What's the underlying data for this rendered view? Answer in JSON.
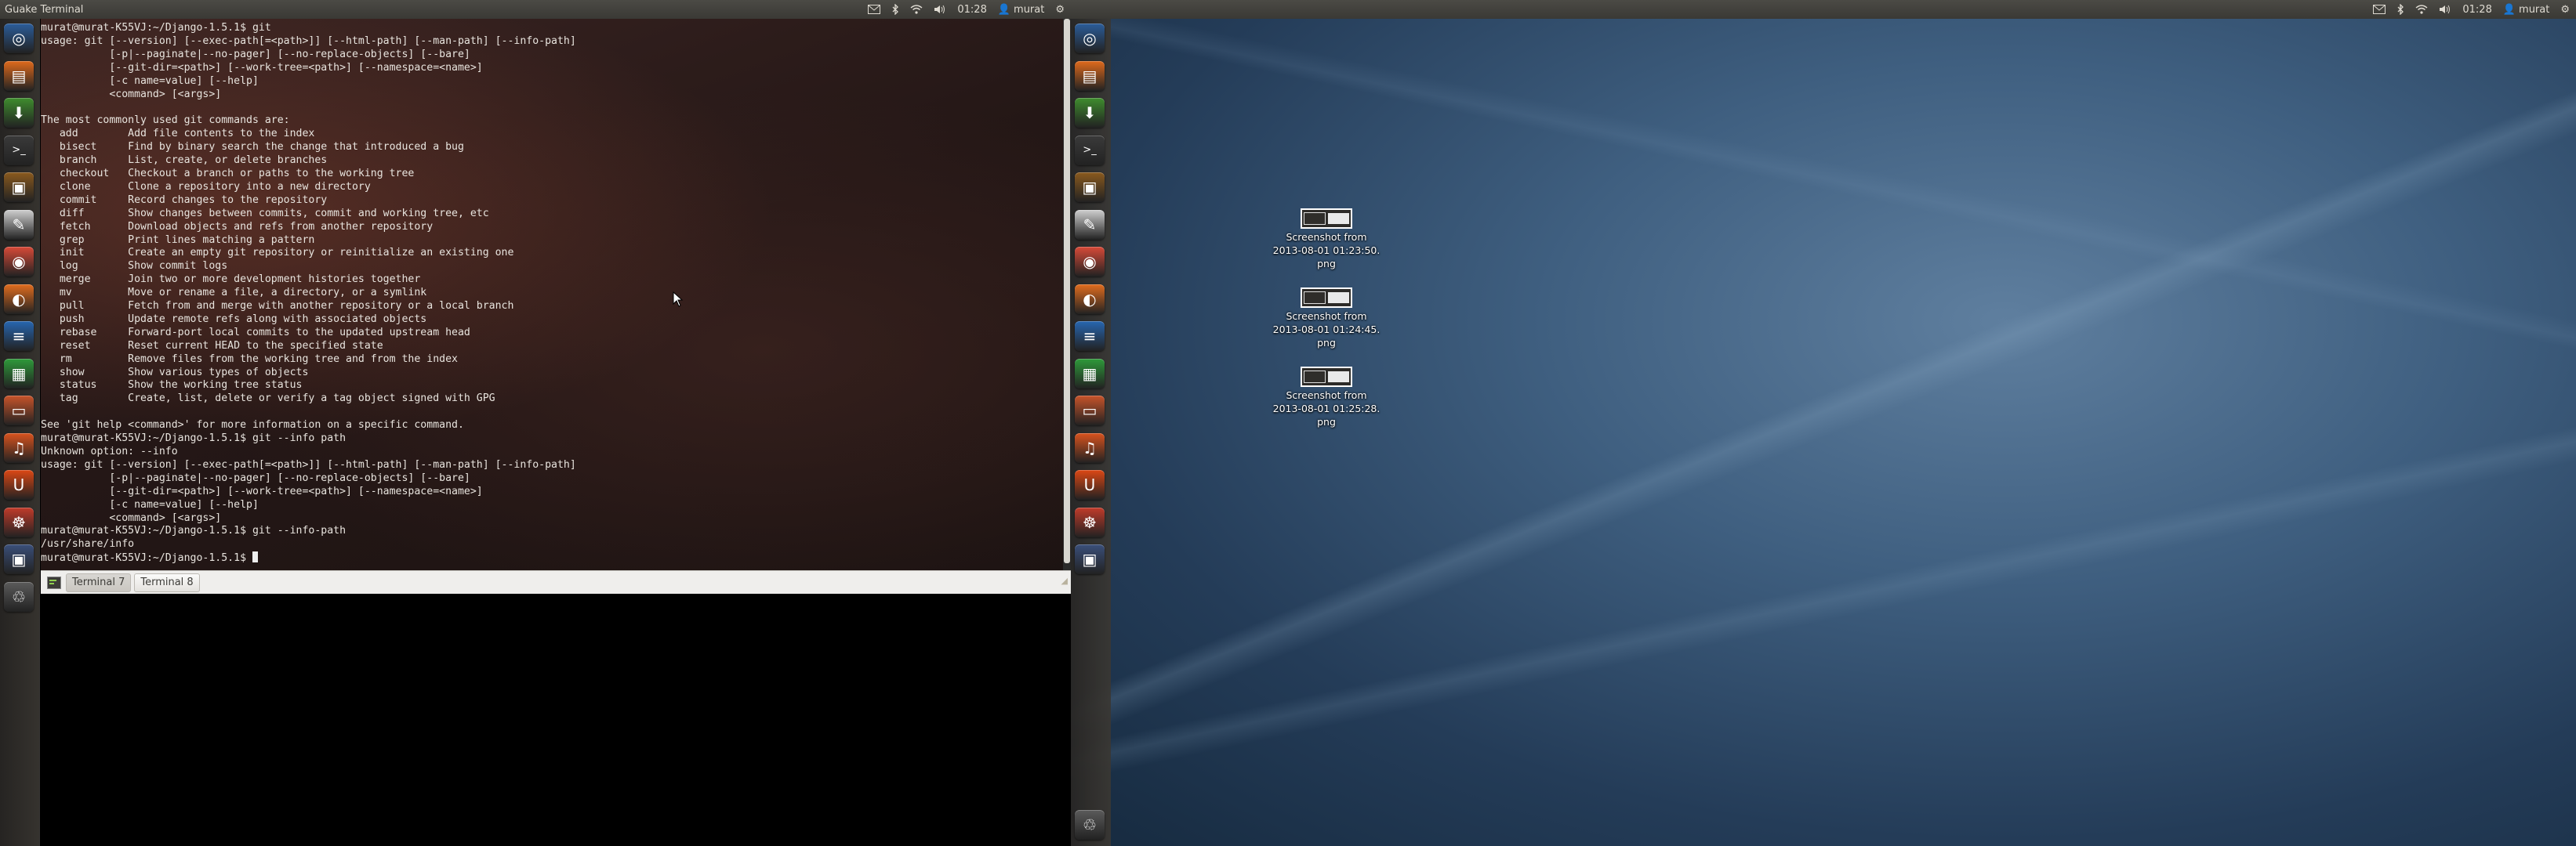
{
  "left_panel": {
    "app_title": "Guake Terminal",
    "time": "01:28",
    "user": "murat",
    "icons": [
      "mail-icon",
      "bluetooth-icon",
      "wifi-icon",
      "volume-icon",
      "gear-icon"
    ]
  },
  "right_panel": {
    "time": "01:28",
    "user": "murat"
  },
  "launcher_items": [
    {
      "name": "dash-home-icon",
      "color": "#2b5d9a"
    },
    {
      "name": "files-icon",
      "color": "#e06a1c"
    },
    {
      "name": "software-center-icon",
      "color": "#3f8d2e"
    },
    {
      "name": "terminal-icon",
      "color": "#3a3a3a"
    },
    {
      "name": "guake-icon",
      "color": "#8a5a1e"
    },
    {
      "name": "text-editor-icon",
      "color": "#cfcfcf"
    },
    {
      "name": "chrome-icon",
      "color": "#d94a38"
    },
    {
      "name": "firefox-icon",
      "color": "#e26d1e"
    },
    {
      "name": "libreoffice-writer-icon",
      "color": "#2766b0"
    },
    {
      "name": "libreoffice-calc-icon",
      "color": "#2e9a3a"
    },
    {
      "name": "libreoffice-impress-icon",
      "color": "#c9542a"
    },
    {
      "name": "ubuntu-one-music-icon",
      "color": "#d9531e"
    },
    {
      "name": "ubuntu-one-icon",
      "color": "#dd4814"
    },
    {
      "name": "help-icon",
      "color": "#c23b2a"
    },
    {
      "name": "workspace-switcher-icon",
      "color": "#3a4f7a"
    },
    {
      "name": "trash-icon",
      "color": "#5b5b5b"
    }
  ],
  "terminal": {
    "lines": [
      "murat@murat-K55VJ:~/Django-1.5.1$ git",
      "usage: git [--version] [--exec-path[=<path>]] [--html-path] [--man-path] [--info-path]",
      "           [-p|--paginate|--no-pager] [--no-replace-objects] [--bare]",
      "           [--git-dir=<path>] [--work-tree=<path>] [--namespace=<name>]",
      "           [-c name=value] [--help]",
      "           <command> [<args>]",
      "",
      "The most commonly used git commands are:",
      "   add        Add file contents to the index",
      "   bisect     Find by binary search the change that introduced a bug",
      "   branch     List, create, or delete branches",
      "   checkout   Checkout a branch or paths to the working tree",
      "   clone      Clone a repository into a new directory",
      "   commit     Record changes to the repository",
      "   diff       Show changes between commits, commit and working tree, etc",
      "   fetch      Download objects and refs from another repository",
      "   grep       Print lines matching a pattern",
      "   init       Create an empty git repository or reinitialize an existing one",
      "   log        Show commit logs",
      "   merge      Join two or more development histories together",
      "   mv         Move or rename a file, a directory, or a symlink",
      "   pull       Fetch from and merge with another repository or a local branch",
      "   push       Update remote refs along with associated objects",
      "   rebase     Forward-port local commits to the updated upstream head",
      "   reset      Reset current HEAD to the specified state",
      "   rm         Remove files from the working tree and from the index",
      "   show       Show various types of objects",
      "   status     Show the working tree status",
      "   tag        Create, list, delete or verify a tag object signed with GPG",
      "",
      "See 'git help <command>' for more information on a specific command.",
      "murat@murat-K55VJ:~/Django-1.5.1$ git --info path",
      "Unknown option: --info",
      "usage: git [--version] [--exec-path[=<path>]] [--html-path] [--man-path] [--info-path]",
      "           [-p|--paginate|--no-pager] [--no-replace-objects] [--bare]",
      "           [--git-dir=<path>] [--work-tree=<path>] [--namespace=<name>]",
      "           [-c name=value] [--help]",
      "           <command> [<args>]",
      "murat@murat-K55VJ:~/Django-1.5.1$ git --info-path",
      "/usr/share/info"
    ],
    "prompt": "murat@murat-K55VJ:~/Django-1.5.1$ "
  },
  "tabs": [
    {
      "label": "Terminal 7",
      "active": true
    },
    {
      "label": "Terminal 8",
      "active": false
    }
  ],
  "desktop_icons": [
    {
      "line1": "Screenshot from",
      "line2": "2013-08-01 01:23:50.",
      "line3": "png"
    },
    {
      "line1": "Screenshot from",
      "line2": "2013-08-01 01:24:45.",
      "line3": "png"
    },
    {
      "line1": "Screenshot from",
      "line2": "2013-08-01 01:25:28.",
      "line3": "png"
    }
  ]
}
